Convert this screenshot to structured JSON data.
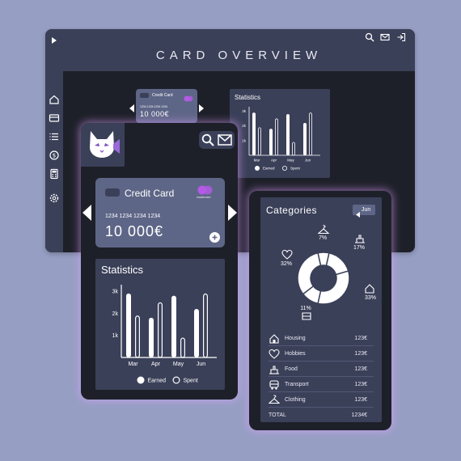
{
  "desktop": {
    "title": "CARD OVERVIEW",
    "card": {
      "label": "Credit Card",
      "number": "1234 1234 1234 1234",
      "amount": "10 000€"
    },
    "stats": {
      "title": "Statistics",
      "yticks": [
        "3k",
        "2k",
        "1k"
      ],
      "months": [
        "Mar",
        "Apr",
        "May",
        "Jun"
      ],
      "legend_earned": "Earned",
      "legend_spent": "Spent"
    },
    "sidebar_icons": [
      "home-icon",
      "card-icon",
      "list-icon",
      "money-icon",
      "calculator-icon",
      "settings-icon"
    ],
    "top_icons": [
      "search-icon",
      "mail-icon",
      "logout-icon"
    ]
  },
  "phone1": {
    "card": {
      "label": "Credit Card",
      "brand": "mastercard",
      "number": "1234 1234 1234 1234",
      "amount": "10 000€"
    },
    "stats": {
      "title": "Statistics",
      "legend_earned": "Earned",
      "legend_spent": "Spent"
    }
  },
  "chart_data": {
    "type": "bar",
    "title": "Statistics",
    "categories": [
      "Mar",
      "Apr",
      "May",
      "Jun"
    ],
    "series": [
      {
        "name": "Earned",
        "values": [
          2.9,
          1.8,
          2.8,
          2.2
        ]
      },
      {
        "name": "Spent",
        "values": [
          1.9,
          2.5,
          0.9,
          2.9
        ]
      }
    ],
    "yticks": [
      "3k",
      "2k",
      "1k"
    ],
    "ylim": [
      0,
      3.3
    ],
    "legend": "bottom",
    "colors": {
      "earned": "#ffffff",
      "spent": "#ffffff"
    }
  },
  "phone2": {
    "title": "Categories",
    "month_selector": "Jun",
    "donut": [
      {
        "label": "32%",
        "value": 32,
        "icon": "heart-icon"
      },
      {
        "label": "7%",
        "value": 7,
        "icon": "hanger-icon"
      },
      {
        "label": "17%",
        "value": 17,
        "icon": "food-icon"
      },
      {
        "label": "33%",
        "value": 33,
        "icon": "house-icon"
      },
      {
        "label": "11%",
        "value": 11,
        "icon": "bus-icon"
      }
    ],
    "rows": [
      {
        "name": "Housing",
        "value": "123€",
        "icon": "house-icon"
      },
      {
        "name": "Hobbies",
        "value": "123€",
        "icon": "heart-icon"
      },
      {
        "name": "Food",
        "value": "123€",
        "icon": "food-icon"
      },
      {
        "name": "Transport",
        "value": "123€",
        "icon": "bus-icon"
      },
      {
        "name": "Clothing",
        "value": "123€",
        "icon": "hanger-icon"
      }
    ],
    "total": {
      "label": "TOTAL",
      "value": "1234€"
    }
  },
  "colors": {
    "background": "#969fc3",
    "panel_dark": "#1e2029",
    "panel": "#3b4059",
    "card": "#5e6687",
    "accent_glow": "#dca0ff",
    "mastercard": "#b45ae6"
  }
}
